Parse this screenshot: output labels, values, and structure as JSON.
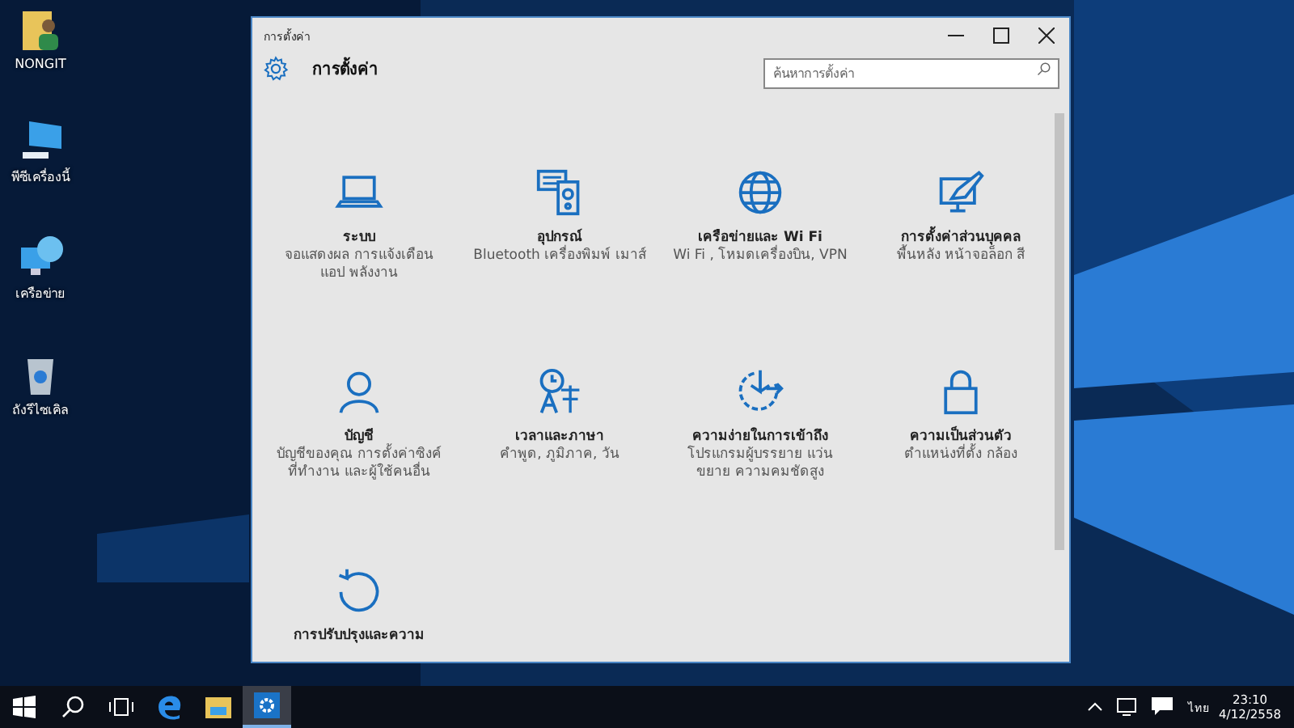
{
  "desktop_icons": [
    {
      "label": "NONGIT",
      "kind": "folder"
    },
    {
      "label": "พีซีเครื่องนี้",
      "kind": "pc"
    },
    {
      "label": "เครือข่าย",
      "kind": "network"
    },
    {
      "label": "ถังรีไซเคิล",
      "kind": "bin"
    }
  ],
  "window": {
    "title": "การตั้งค่า",
    "heading": "การตั้งค่า",
    "search": {
      "placeholder": "ค้นหาการตั้งค่า"
    }
  },
  "categories": [
    {
      "kind": "laptop",
      "title": "ระบบ",
      "description": "จอแสดงผล การแจ้งเตือน แอป พลังงาน"
    },
    {
      "kind": "devices",
      "title": "อุปกรณ์",
      "description": "Bluetooth เครื่องพิมพ์ เมาส์"
    },
    {
      "kind": "globe",
      "title": "เครือข่ายและ Wi Fi",
      "description": "Wi Fi , โหมดเครื่องบิน, VPN"
    },
    {
      "kind": "paint",
      "title": "การตั้งค่าส่วนบุคคล",
      "description": "พื้นหลัง หน้าจอล็อก สี"
    },
    {
      "kind": "person",
      "title": "บัญชี",
      "description": "บัญชีของคุณ การตั้งค่าซิงค์ ที่ทำงาน และผู้ใช้คนอื่น"
    },
    {
      "kind": "language",
      "title": "เวลาและภาษา",
      "description": "คำพูด, ภูมิภาค, วัน"
    },
    {
      "kind": "ease",
      "title": "ความง่ายในการเข้าถึง",
      "description": "โปรแกรมผู้บรรยาย แว่นขยาย ความคมชัดสูง"
    },
    {
      "kind": "lock",
      "title": "ความเป็นส่วนตัว",
      "description": "ตำแหน่งที่ตั้ง กล้อง"
    },
    {
      "kind": "update",
      "title": "การปรับปรุงและความ"
    }
  ],
  "taskbar": {
    "apps": [
      {
        "kind": "edge",
        "selected": false
      },
      {
        "kind": "explorer",
        "selected": false
      },
      {
        "kind": "settings",
        "selected": true
      }
    ],
    "language": "ไทย",
    "time": "23:10",
    "date": "4/12/2558"
  }
}
